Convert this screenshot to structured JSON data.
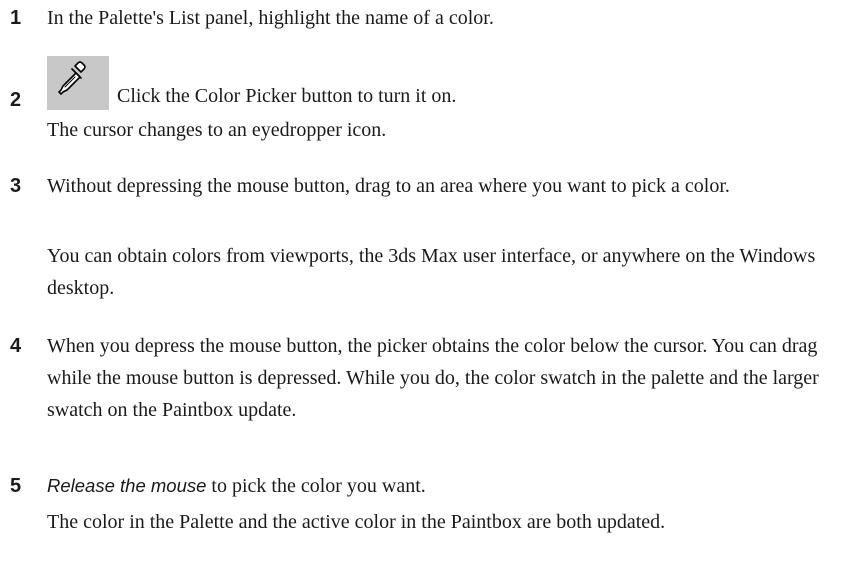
{
  "steps": [
    {
      "number": "1",
      "text": "In the Palette's List panel, highlight the name of a color."
    },
    {
      "number": "2",
      "icon": "eyedropper-icon",
      "text": "Click the Color Picker button to turn it on.",
      "note": "The cursor changes to an eyedropper icon."
    },
    {
      "number": "3",
      "text": "Without depressing the mouse button, drag to an area where you want to pick a color.",
      "note": "You can obtain colors from viewports, the 3ds Max user interface, or anywhere on the Windows desktop."
    },
    {
      "number": "4",
      "text": "When you depress the mouse button, the picker obtains the color below the cursor. You can drag while the mouse button is depressed. While you do, the color swatch in the palette and the larger swatch on the Paintbox update."
    },
    {
      "number": "5",
      "text_emphasis": "Release the mouse",
      "text": " to pick the color you want.",
      "note": "The color in the Palette and the active color in the Paintbox are both updated."
    }
  ],
  "colors": {
    "text": "#1a1a1a",
    "button_bg": "#c8c8c8"
  }
}
